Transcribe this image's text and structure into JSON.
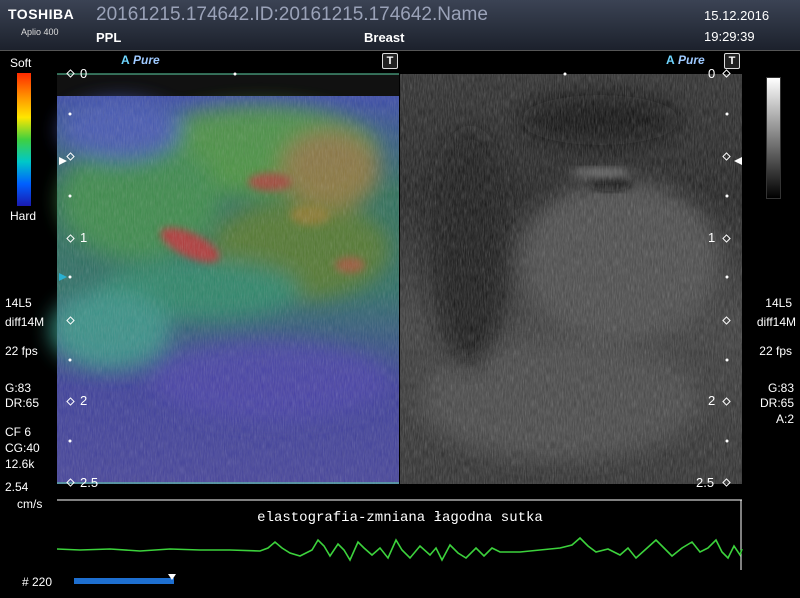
{
  "header": {
    "brand": "TOSHIBA",
    "model": "Aplio 400",
    "filename": "20161215.174642.ID:20161215.174642.Name",
    "preset": "PPL",
    "organ": "Breast",
    "date": "15.12.2016",
    "time": "19:29:39"
  },
  "scale_bar": {
    "top_label": "Soft",
    "bottom_label": "Hard"
  },
  "left_panel": {
    "mode_label": "A Pure",
    "mode_prefix": "A",
    "mode_suffix": "Pure",
    "t_button": "T",
    "depth_marks": [
      "0",
      "1",
      "2",
      "2.5"
    ]
  },
  "right_panel": {
    "mode_prefix": "A",
    "mode_suffix": "Pure",
    "t_button": "T",
    "depth_marks": [
      "0",
      "1",
      "2",
      "2.5"
    ]
  },
  "left_params": {
    "probe": "14L5",
    "diff": "diff14M",
    "fps": "22 fps",
    "gain": "G:83",
    "dr": "DR:65",
    "cf": "CF 6",
    "cg": "CG:40",
    "prf": "12.6k",
    "vel": "2.54",
    "vel_unit": "cm/s"
  },
  "right_params": {
    "probe": "14L5",
    "diff": "diff14M",
    "fps": "22 fps",
    "gain": "G:83",
    "dr": "DR:65",
    "a": "A:2"
  },
  "caption": "elastografia-zmniana łagodna sutka",
  "frame_counter": "# 220",
  "colors": {
    "waveform": "#3cd23c",
    "depth_line": "#5fd4a8",
    "progress": "#1e6fd0"
  }
}
